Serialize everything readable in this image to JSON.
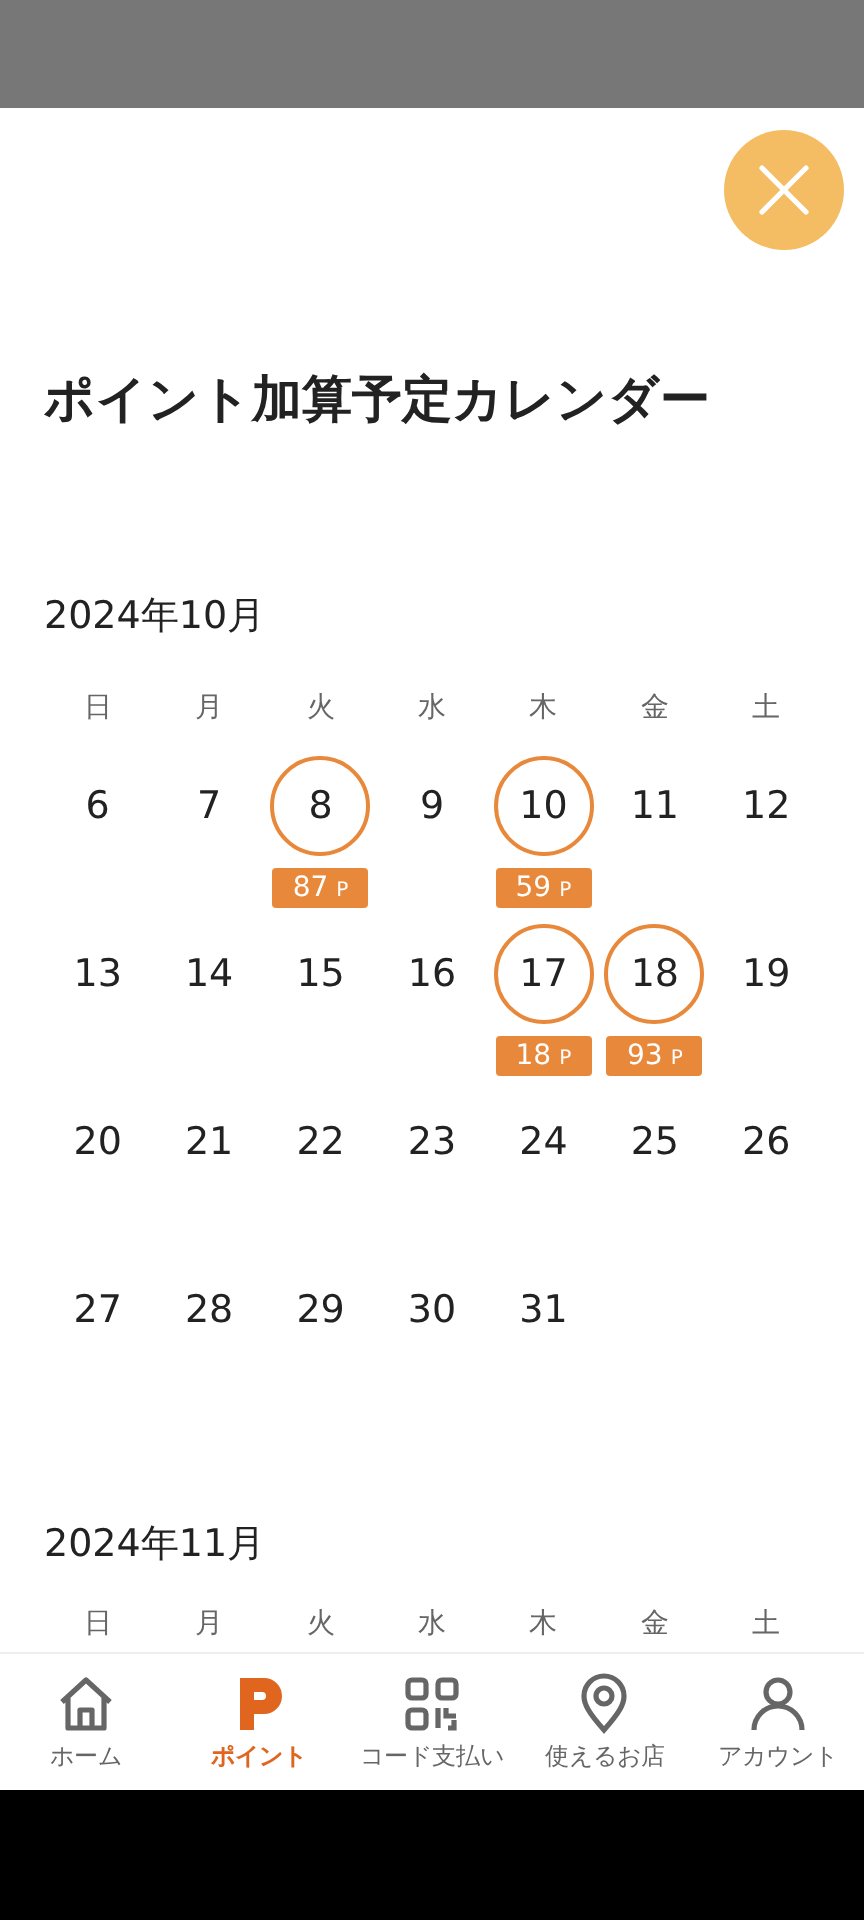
{
  "title": "ポイント加算予定カレンダー",
  "months": [
    {
      "label": "2024年10月",
      "weekdays": [
        "日",
        "月",
        "火",
        "水",
        "木",
        "金",
        "土"
      ],
      "weeks": [
        [
          {
            "day": "6",
            "marked": false
          },
          {
            "day": "7",
            "marked": false
          },
          {
            "day": "8",
            "marked": true,
            "points": "87",
            "unit": "P"
          },
          {
            "day": "9",
            "marked": false
          },
          {
            "day": "10",
            "marked": true,
            "points": "59",
            "unit": "P"
          },
          {
            "day": "11",
            "marked": false
          },
          {
            "day": "12",
            "marked": false
          }
        ],
        [
          {
            "day": "13",
            "marked": false
          },
          {
            "day": "14",
            "marked": false
          },
          {
            "day": "15",
            "marked": false
          },
          {
            "day": "16",
            "marked": false
          },
          {
            "day": "17",
            "marked": true,
            "points": "18",
            "unit": "P"
          },
          {
            "day": "18",
            "marked": true,
            "points": "93",
            "unit": "P"
          },
          {
            "day": "19",
            "marked": false
          }
        ],
        [
          {
            "day": "20",
            "marked": false
          },
          {
            "day": "21",
            "marked": false
          },
          {
            "day": "22",
            "marked": false
          },
          {
            "day": "23",
            "marked": false
          },
          {
            "day": "24",
            "marked": false
          },
          {
            "day": "25",
            "marked": false
          },
          {
            "day": "26",
            "marked": false
          }
        ],
        [
          {
            "day": "27",
            "marked": false
          },
          {
            "day": "28",
            "marked": false
          },
          {
            "day": "29",
            "marked": false
          },
          {
            "day": "30",
            "marked": false
          },
          {
            "day": "31",
            "marked": false
          }
        ]
      ]
    },
    {
      "label": "2024年11月",
      "weekdays": [
        "日",
        "月",
        "火",
        "水",
        "木",
        "金",
        "土"
      ]
    }
  ],
  "nav": [
    {
      "kind": "home",
      "label": "ホーム",
      "selected": false
    },
    {
      "kind": "point",
      "label": "ポイント",
      "selected": true
    },
    {
      "kind": "qr",
      "label": "コード支払い",
      "selected": false
    },
    {
      "kind": "pin",
      "label": "使えるお店",
      "selected": false
    },
    {
      "kind": "person",
      "label": "アカウント",
      "selected": false
    }
  ]
}
